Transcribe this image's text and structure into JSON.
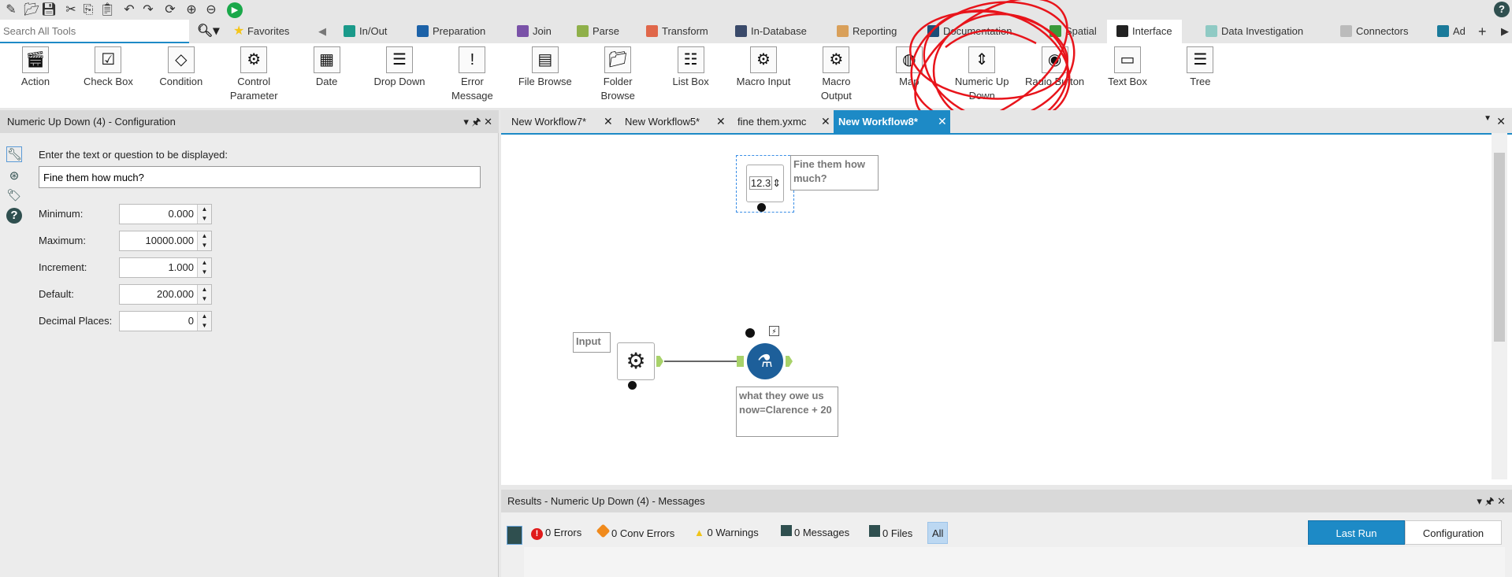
{
  "quick_access": [
    "new",
    "open",
    "save",
    "cut",
    "copy",
    "paste",
    "undo",
    "redo",
    "refresh",
    "zoom-in",
    "zoom-out",
    "run"
  ],
  "search": {
    "placeholder": "Search All Tools"
  },
  "favorites": "Favorites",
  "categories": [
    {
      "label": "In/Out",
      "color": "#1a9a8a"
    },
    {
      "label": "Preparation",
      "color": "#1c62a8"
    },
    {
      "label": "Join",
      "color": "#7a52a8"
    },
    {
      "label": "Parse",
      "color": "#8fb04a"
    },
    {
      "label": "Transform",
      "color": "#e0674a"
    },
    {
      "label": "In-Database",
      "color": "#3a4a6a"
    },
    {
      "label": "Reporting",
      "color": "#d9a05a"
    },
    {
      "label": "Documentation",
      "color": "#1c4e78"
    },
    {
      "label": "Spatial",
      "color": "#3a9a3a"
    },
    {
      "label": "Interface",
      "color": "#222222",
      "active": true
    },
    {
      "label": "Data Investigation",
      "color": "#8fcac4"
    },
    {
      "label": "Connectors",
      "color": "#bbbbbb"
    },
    {
      "label": "Ad",
      "color": "#1a7a9a"
    }
  ],
  "tools": [
    "Action",
    "Check Box",
    "Condition",
    "Control Parameter",
    "Date",
    "Drop Down",
    "Error Message",
    "File Browse",
    "Folder Browse",
    "List Box",
    "Macro Input",
    "Macro Output",
    "Map",
    "Numeric Up Down",
    "Radio Button",
    "Text Box",
    "Tree"
  ],
  "config": {
    "title": "Numeric Up Down (4) - Configuration",
    "prompt_label": "Enter the text or question to be displayed:",
    "prompt_value": "Fine them how much?",
    "fields": [
      {
        "label": "Minimum:",
        "value": "0.000"
      },
      {
        "label": "Maximum:",
        "value": "10000.000"
      },
      {
        "label": "Increment:",
        "value": "1.000"
      },
      {
        "label": "Default:",
        "value": "200.000"
      },
      {
        "label": "Decimal Places:",
        "value": "0"
      }
    ]
  },
  "canvas_tabs": [
    {
      "label": "New Workflow7*"
    },
    {
      "label": "New Workflow5*"
    },
    {
      "label": "fine them.yxmc"
    },
    {
      "label": "New Workflow8*",
      "active": true
    }
  ],
  "canvas": {
    "numeric_icon_text": "12.3",
    "numeric_annotation": "Fine them how much?",
    "input_annotation": "Input",
    "formula_annotation": "what they owe us now=Clarence + 20"
  },
  "results": {
    "title": "Results - Numeric Up Down (4) - Messages",
    "errors": "0 Errors",
    "conv_errors": "0 Conv Errors",
    "warnings": "0 Warnings",
    "messages": "0 Messages",
    "files": "0 Files",
    "all": "All",
    "last_run": "Last Run",
    "configuration": "Configuration"
  },
  "colors": {
    "accent": "#1d8ac6",
    "annotation_scribble": "#e8141b"
  }
}
